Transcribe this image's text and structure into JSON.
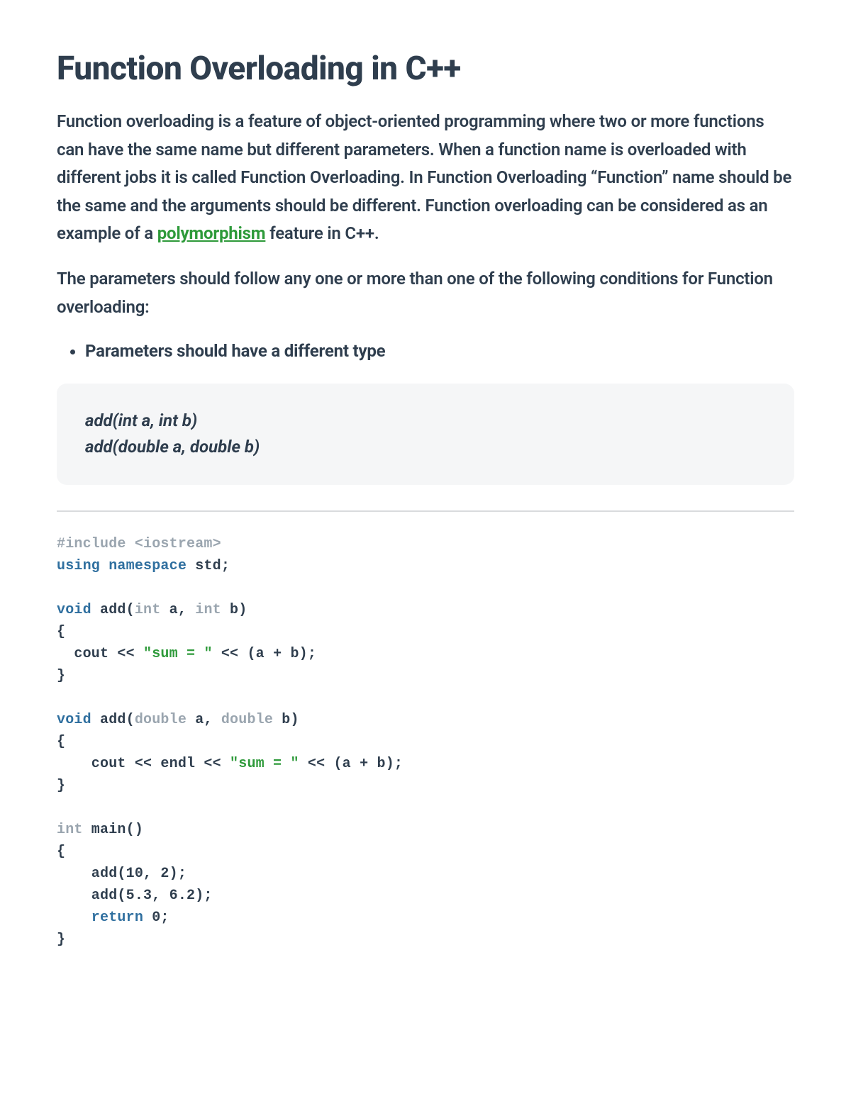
{
  "title": "Function Overloading in C++",
  "para1_pre": "Function overloading is a feature of object-oriented programming where two or more functions can have the same name but different parameters. When a function name is overloaded with different jobs it is called Function Overloading. In Function Overloading “Function” name should be the same and the arguments should be different. Function overloading can be considered as an example of a ",
  "para1_link": "polymorphism",
  "para1_post": " feature in C++.",
  "para2": "The parameters should follow any one or more than one of the following conditions for Function overloading:",
  "bullet1": "Parameters should have a different type",
  "example_line1": "add(int a, int b)",
  "example_line2": "add(double a, double b)",
  "code": {
    "t_include": "#include <iostream>",
    "t_using": "using",
    "t_namespace": "namespace",
    "t_std": " std;",
    "t_void1": "void",
    "t_add1_sig_a": " add(",
    "t_int1": "int",
    "t_add1_sig_b": " a, ",
    "t_int2": "int",
    "t_add1_sig_c": " b)",
    "t_lbrace1": "{",
    "t_body1_a": "  cout << ",
    "t_str1": "\"sum = \"",
    "t_body1_b": " << (a + b);",
    "t_rbrace1": "}",
    "t_void2": "void",
    "t_add2_sig_a": " add(",
    "t_double1": "double",
    "t_add2_sig_b": " a, ",
    "t_double2": "double",
    "t_add2_sig_c": " b)",
    "t_lbrace2": "{",
    "t_body2_a": "    cout << endl << ",
    "t_str2": "\"sum = \"",
    "t_body2_b": " << (a + b);",
    "t_rbrace2": "}",
    "t_int3": "int",
    "t_main_sig": " main()",
    "t_lbrace3": "{",
    "t_call1": "    add(10, 2);",
    "t_call2": "    add(5.3, 6.2);",
    "t_return": "    return",
    "t_return_val": " 0;",
    "t_rbrace3": "}"
  }
}
